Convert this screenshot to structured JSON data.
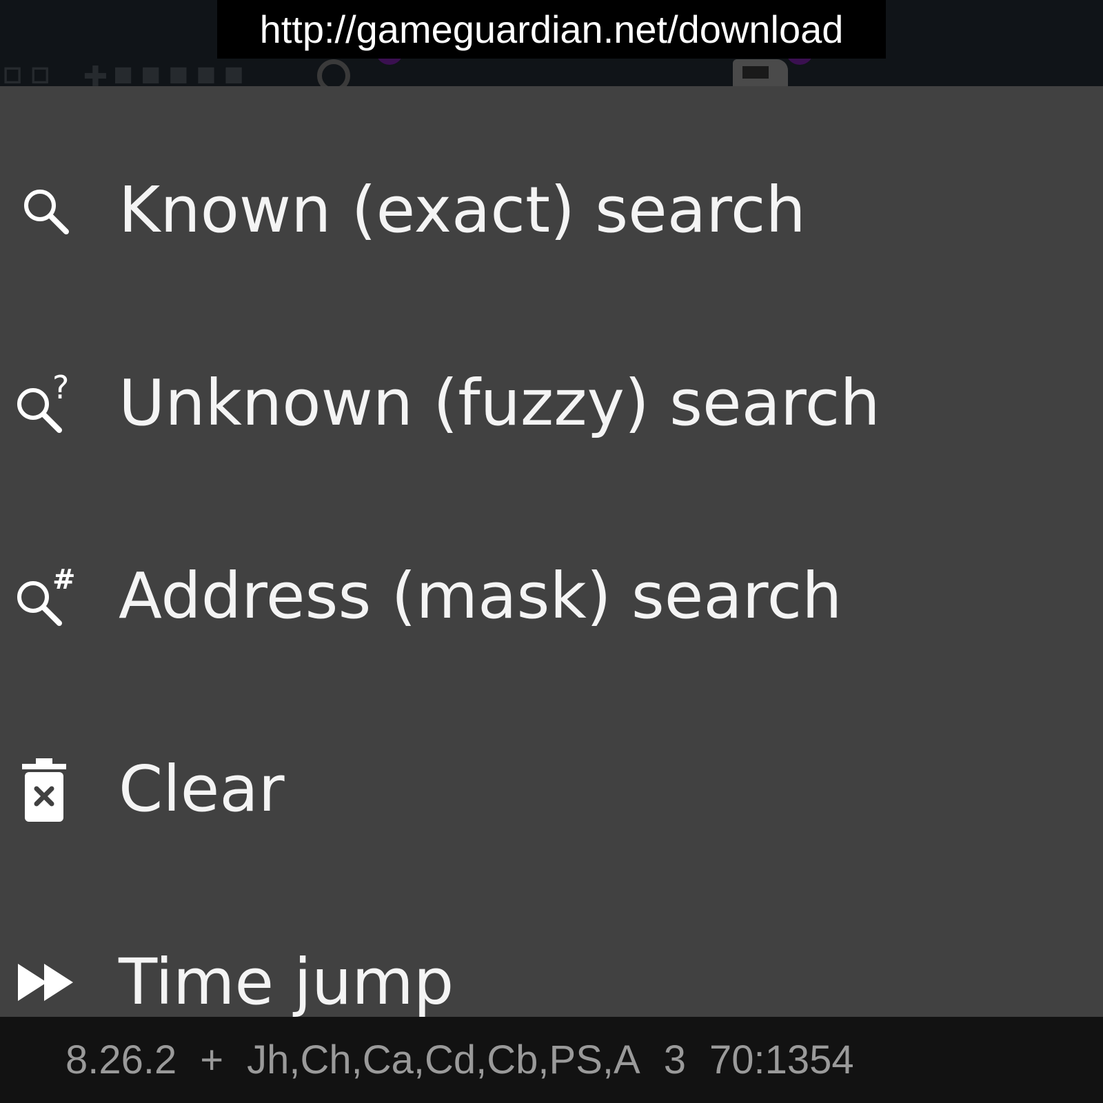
{
  "url_banner": {
    "text": "http://gameguardian.net/download"
  },
  "menu": {
    "items": [
      {
        "icon": "search-icon",
        "label": "Known (exact) search"
      },
      {
        "icon": "search-question-icon",
        "label": "Unknown (fuzzy) search"
      },
      {
        "icon": "search-hash-icon",
        "label": "Address (mask) search"
      },
      {
        "icon": "trash-x-icon",
        "label": "Clear"
      },
      {
        "icon": "fast-forward-icon",
        "label": "Time jump"
      }
    ]
  },
  "status_bar": {
    "version": "8.26.2",
    "plus": "+",
    "regions": "Jh,Ch,Ca,Cd,Cb,PS,A",
    "count": "3",
    "process": "70:1354"
  },
  "colors": {
    "menu_background": "#414141",
    "menu_text": "#f4f4f4",
    "status_text": "#9a9a9a",
    "banner_background": "#000000"
  }
}
